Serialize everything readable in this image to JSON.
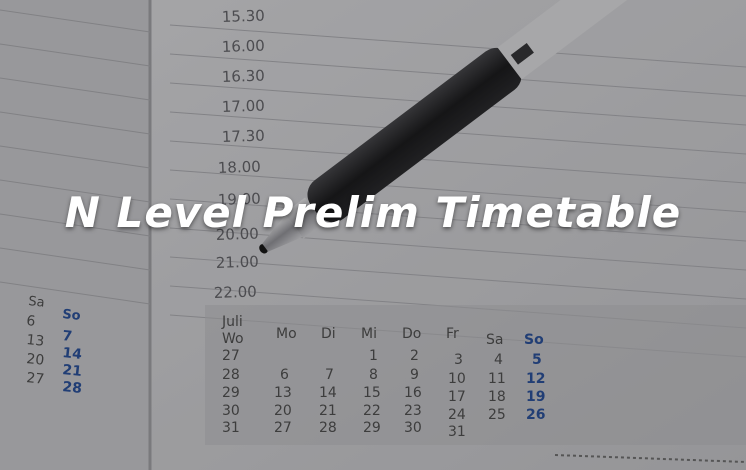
{
  "title": "N Level Prelim Timetable",
  "planner": {
    "times": [
      "15.30",
      "16.00",
      "16.30",
      "17.00",
      "17.30",
      "18.00",
      "19.00",
      "20.00",
      "21.00",
      "22.00"
    ],
    "month": "Juli",
    "week_label": "Wo",
    "weekdays": [
      "Mo",
      "Di",
      "Mi",
      "Do",
      "Fr",
      "Sa",
      "So"
    ],
    "weeks": [
      "27",
      "28",
      "29",
      "30",
      "31"
    ],
    "days": [
      [
        "",
        "",
        "1",
        "2",
        "3",
        "4",
        "5"
      ],
      [
        "6",
        "7",
        "8",
        "9",
        "10",
        "11",
        "12"
      ],
      [
        "13",
        "14",
        "15",
        "16",
        "17",
        "18",
        "19"
      ],
      [
        "20",
        "21",
        "22",
        "23",
        "24",
        "25",
        "26"
      ],
      [
        "27",
        "28",
        "29",
        "30",
        "31",
        "",
        ""
      ]
    ],
    "left_page": {
      "weekdays": [
        "Sa",
        "So"
      ],
      "rows": [
        [
          "6",
          "7"
        ],
        [
          "13",
          "14"
        ],
        [
          "20",
          "21"
        ],
        [
          "27",
          "28"
        ]
      ]
    }
  },
  "colors": {
    "paper": "#d9d9dc",
    "ink": "#555555",
    "sunday": "#2f56a3",
    "pen_body": "#2a2a2c",
    "pen_chrome": "#c9c9cc"
  }
}
